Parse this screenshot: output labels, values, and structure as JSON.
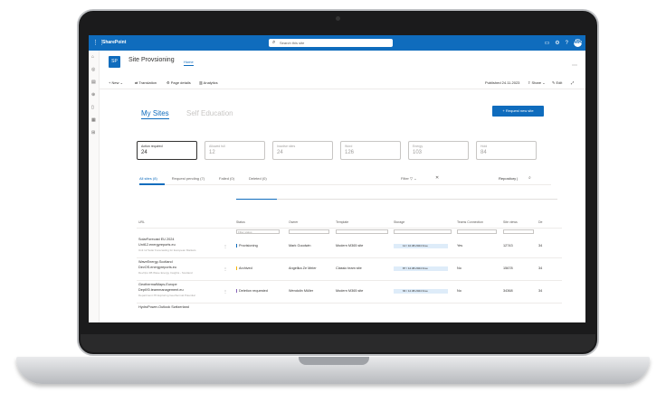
{
  "app": {
    "name": "SharePoint",
    "search_placeholder": "Search this site",
    "avatar_initials": "MK"
  },
  "site": {
    "logo": "SP",
    "title": "Site Provsioning",
    "nav_home": "Home"
  },
  "commands": {
    "new": "New",
    "translation": "Translation",
    "page_details": "Page details",
    "analytics": "Analytics",
    "published": "Published 24.11.2023",
    "share": "Share",
    "edit": "Edit"
  },
  "tabs": {
    "my_sites": "My Sites",
    "self_education": "Self Education"
  },
  "request_button": "+ Request new site",
  "cards": [
    {
      "label": "Action required",
      "value": "24"
    },
    {
      "label": "Allowed full",
      "value": "12"
    },
    {
      "label": "Inactive sites",
      "value": "24"
    },
    {
      "label": "Word",
      "value": "126"
    },
    {
      "label": "Energy",
      "value": "103"
    },
    {
      "label": "Hold",
      "value": "84"
    }
  ],
  "filter_tabs": [
    "All sites (8)",
    "Request pending (7)",
    "Failed (0)",
    "Deleted (0)"
  ],
  "filter_label": "Filter",
  "repository_label": "Repository",
  "columns": [
    "URL",
    "Status",
    "Owner",
    "Template",
    "Storage",
    "Teams Connection",
    "Site views",
    "De"
  ],
  "filter_placeholder": "Filter status",
  "rows": [
    {
      "title": "SolarForecast EU 2024",
      "url": "Unit12.energyreports.eu",
      "desc": "Unit 12 Solar Forecasting for European Markets",
      "status": "Provisioning",
      "owner": "Mark Goodwin",
      "template": "Modern M365 site",
      "storage": "12 / 10.08.2024 Free",
      "teams": "Yes",
      "views": "12743",
      "de": "34"
    },
    {
      "title": "WaveEnergy-Scotland",
      "url": "DevOS.energyreports.eu",
      "desc": "DevOps 3B Wave Energy Insights - Scotland",
      "status": "Archived",
      "owner": "Angelika Ze Meier",
      "template": "Classic team site",
      "storage": "87 / 12.08.2024 Free",
      "teams": "No",
      "views": "15678",
      "de": "34"
    },
    {
      "title": "GeothermalMaps-Europe",
      "url": "DeptX5.teammanagement.eu",
      "desc": "Department X5 Exploring Geothermal Potential",
      "status": "Deletion requested",
      "owner": "Wendolin Müller",
      "template": "Modern M365 site",
      "storage": "66 / 12.08.2024 Free",
      "teams": "No",
      "views": "34368",
      "de": "34"
    },
    {
      "title": "HydroPower-Outlook Switzerland",
      "url": "",
      "desc": "",
      "status": "",
      "owner": "",
      "template": "",
      "storage": "",
      "teams": "",
      "views": "",
      "de": ""
    }
  ],
  "status_colors": {
    "Provisioning": "#0f6cbd",
    "Archived": "#f7b500",
    "Deletion requested": "#8764b8"
  }
}
